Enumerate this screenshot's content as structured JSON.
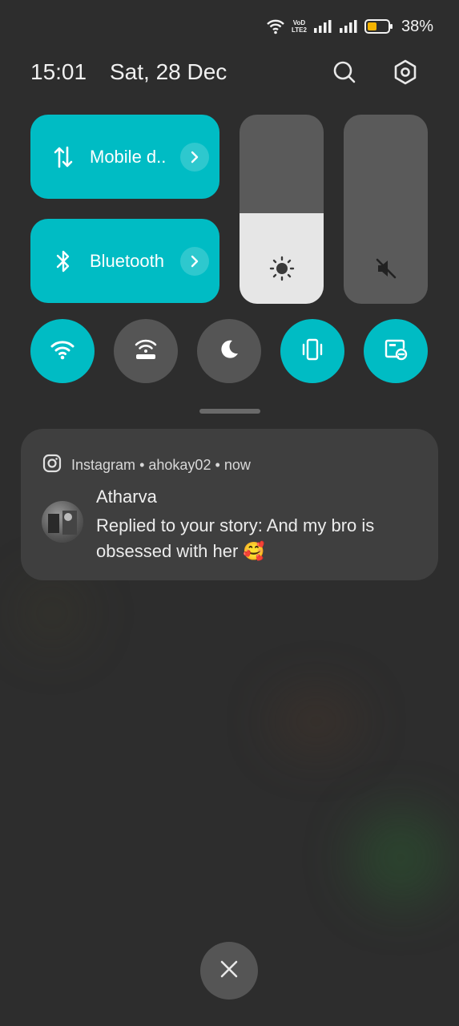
{
  "status_bar": {
    "wifi_icon": "wifi-icon",
    "network_label": "VoLTE 2",
    "battery": "38%",
    "battery_color": "#f5b400"
  },
  "header": {
    "time": "15:01",
    "date": "Sat, 28 Dec",
    "search_icon": "search-icon",
    "settings_icon": "settings-icon"
  },
  "tiles": [
    {
      "label": "Mobile d..",
      "icon": "mobile-data-icon",
      "state": "on"
    },
    {
      "label": "Bluetooth",
      "icon": "bluetooth-icon",
      "state": "on"
    }
  ],
  "sliders": {
    "brightness": {
      "icon": "brightness-icon",
      "level": 0.48
    },
    "volume": {
      "icon": "mute-icon",
      "level": 0
    }
  },
  "toggles": [
    {
      "name": "wifi",
      "icon": "wifi-icon",
      "state": "on"
    },
    {
      "name": "hotspot",
      "icon": "hotspot-icon",
      "state": "off"
    },
    {
      "name": "dark-mode",
      "icon": "moon-icon",
      "state": "off"
    },
    {
      "name": "vibrate",
      "icon": "vibrate-icon",
      "state": "on"
    },
    {
      "name": "screen-cast",
      "icon": "cast-icon",
      "state": "on"
    }
  ],
  "notification": {
    "app": "Instagram",
    "account": "ahokay02",
    "time": "now",
    "separator": "•",
    "title": "Atharva",
    "body": "Replied to your story: And my bro is obsessed with her 🥰"
  },
  "colors": {
    "accent": "#00bcc4",
    "background": "#2d2d2d",
    "card": "#3f3f3f",
    "inactive": "#555555"
  }
}
